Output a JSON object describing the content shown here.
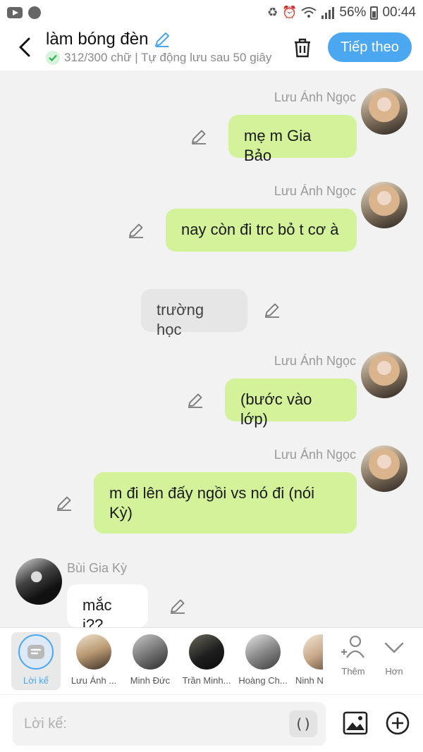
{
  "status_bar": {
    "battery": "56%",
    "time": "00:44"
  },
  "header": {
    "title": "làm bóng đèn",
    "subtitle": "312/300 chữ | Tự động lưu sau 50 giây",
    "next_label": "Tiếp theo"
  },
  "messages": [
    {
      "sender": "Lưu Ánh Ngọc",
      "text": "mẹ m Gia Bảo",
      "side": "right"
    },
    {
      "sender": "Lưu Ánh Ngọc",
      "text": "nay còn đi trc bỏ t cơ à",
      "side": "right"
    },
    {
      "sender": "",
      "text": "trường học",
      "side": "center"
    },
    {
      "sender": "Lưu Ánh Ngọc",
      "text": "(bước vào lớp)",
      "side": "right"
    },
    {
      "sender": "Lưu Ánh Ngọc",
      "text": "m đi lên đấy ngồi vs nó đi (nói Kỳ)",
      "side": "right"
    },
    {
      "sender": "Bùi Gia Kỳ",
      "text": "mắc j??",
      "side": "left"
    }
  ],
  "characters": [
    {
      "label": "Lời kể",
      "selected": true
    },
    {
      "label": "Lưu Ánh ..."
    },
    {
      "label": "Minh Đức"
    },
    {
      "label": "Trần Minh..."
    },
    {
      "label": "Hoàng Ch..."
    },
    {
      "label": "Ninh N"
    }
  ],
  "tools": {
    "add_label": "Thêm",
    "more_label": "Hơn"
  },
  "input": {
    "placeholder": "Lời kể:",
    "paren_label": "()"
  },
  "colors": {
    "accent": "#4aa7f0",
    "bubble_green": "#d3f29a"
  }
}
